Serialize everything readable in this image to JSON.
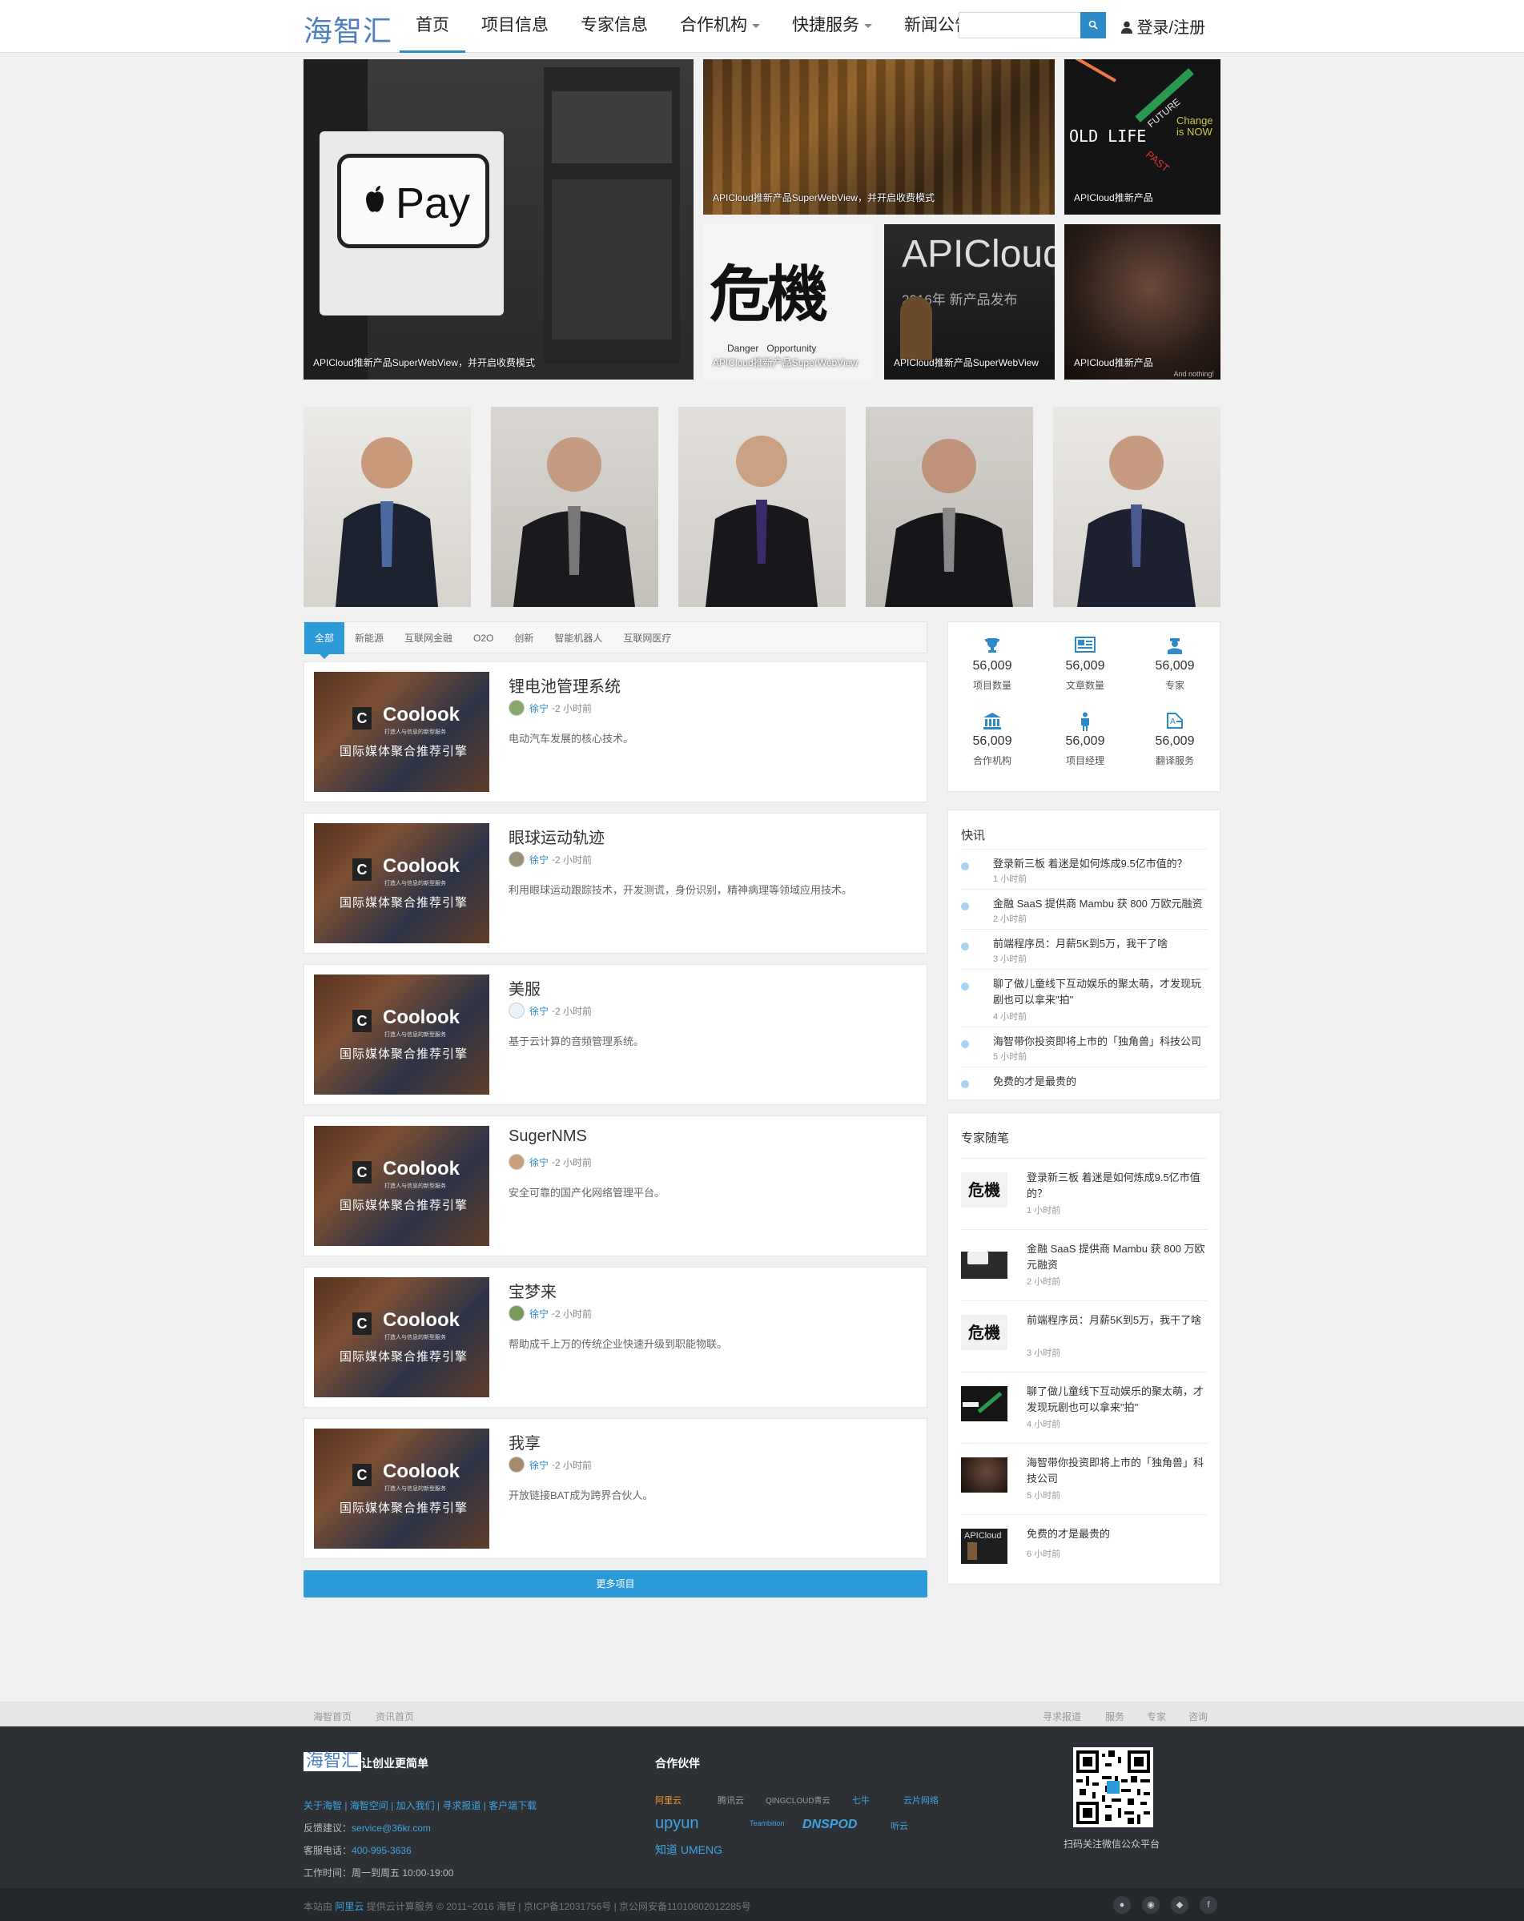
{
  "header": {
    "logo": "海智汇",
    "nav": [
      {
        "label": "首页"
      },
      {
        "label": "项目信息"
      },
      {
        "label": "专家信息"
      },
      {
        "label": "合作机构"
      },
      {
        "label": "快捷服务"
      },
      {
        "label": "新闻公告"
      }
    ],
    "search_placeholder": "",
    "login": "登录/注册"
  },
  "hero": {
    "big": {
      "caption": "APICloud推新产品SuperWebView，并开启收费模式",
      "pay_text": "Pay"
    },
    "tiles": [
      {
        "caption": "APICloud推新产品SuperWebView，并开启收费模式"
      },
      {
        "caption": "APICloud推新产品",
        "overlay_words": [
          "OLD LIFE",
          "FUTURE",
          "PAST",
          "Change is NOW"
        ]
      },
      {
        "caption": "APICloud推新产品SuperWebView",
        "overlay_big": "危機",
        "overlay_small": "Danger   Opportunity"
      },
      {
        "caption": "APICloud推新产品SuperWebView",
        "overlay_big": "APICloud",
        "overlay_small": "2016年 新产品发布"
      },
      {
        "caption": "APICloud推新产品",
        "overlay_small": "And nothing!"
      }
    ]
  },
  "tabs": [
    "全部",
    "新能源",
    "互联网金融",
    "O2O",
    "创新",
    "智能机器人",
    "互联网医疗"
  ],
  "thumb": {
    "brand": "Coolook",
    "sub": "打造人与信息的新型服务",
    "slogan": "国际媒体聚合推荐引擎"
  },
  "projects": [
    {
      "title": "锂电池管理系统",
      "author": "徐宁",
      "time": "2 小时前",
      "desc": "电动汽车发展的核心技术。"
    },
    {
      "title": "眼球运动轨迹",
      "author": "徐宁",
      "time": "2 小时前",
      "desc": "利用眼球运动跟踪技术，开发测谎，身份识别，精神病理等领域应用技术。"
    },
    {
      "title": "美服",
      "author": "徐宁",
      "time": "2 小时前",
      "desc": "基于云计算的音频管理系统。"
    },
    {
      "title": "SugerNMS",
      "author": "徐宁",
      "time": "2 小时前",
      "desc": "安全可靠的国产化网络管理平台。"
    },
    {
      "title": "宝梦来",
      "author": "徐宁",
      "time": "2 小时前",
      "desc": "帮助成千上万的传统企业快速升级到职能物联。"
    },
    {
      "title": "我享",
      "author": "徐宁",
      "time": "2 小时前",
      "desc": "开放链接BAT成为跨界合伙人。"
    }
  ],
  "more_button": "更多项目",
  "stats": [
    {
      "value": "56,009",
      "label": "项目数量",
      "icon": "trophy-icon"
    },
    {
      "value": "56,009",
      "label": "文章数量",
      "icon": "newspaper-icon"
    },
    {
      "value": "56,009",
      "label": "专家",
      "icon": "expert-icon"
    },
    {
      "value": "56,009",
      "label": "合作机构",
      "icon": "bank-icon"
    },
    {
      "value": "56,009",
      "label": "项目经理",
      "icon": "person-icon"
    },
    {
      "value": "56,009",
      "label": "翻译服务",
      "icon": "translate-icon"
    }
  ],
  "flash": {
    "title": "快讯",
    "items": [
      {
        "text": "登录新三板 着迷是如何炼成9.5亿市值的？",
        "time": "1 小时前"
      },
      {
        "text": "金融 SaaS 提供商 Mambu 获 800 万欧元融资",
        "time": "2 小时前"
      },
      {
        "text": "前端程序员：月薪5K到5万，我干了啥",
        "time": "3 小时前"
      },
      {
        "text": "聊了做儿童线下互动娱乐的聚太萌，才发现玩剧也可以拿来\"拍\"",
        "time": "4 小时前"
      },
      {
        "text": "海智带你投资即将上市的「独角兽」科技公司",
        "time": "5 小时前"
      },
      {
        "text": "免费的才是最贵的",
        "time": ""
      }
    ]
  },
  "essays": {
    "title": "专家随笔",
    "items": [
      {
        "text": "登录新三板 着迷是如何炼成9.5亿市值的？",
        "time": "1 小时前"
      },
      {
        "text": "金融 SaaS 提供商 Mambu 获 800 万欧元融资",
        "time": "2 小时前"
      },
      {
        "text": "前端程序员：月薪5K到5万，我干了啥",
        "time": "3 小时前"
      },
      {
        "text": "聊了做儿童线下互动娱乐的聚太萌，才发现玩剧也可以拿来\"拍\"",
        "time": "4 小时前"
      },
      {
        "text": "海智带你投资即将上市的「独角兽」科技公司",
        "time": "5 小时前"
      },
      {
        "text": "免费的才是最贵的",
        "time": "6 小时前"
      }
    ]
  },
  "subfooter": {
    "left": [
      "海智首页",
      "资讯首页"
    ],
    "right": [
      "寻求报道",
      "服务",
      "专家",
      "咨询"
    ]
  },
  "footer": {
    "logo": "海智汇",
    "slogan": "让创业更简单",
    "links": "关于海智 | 海智空间 | 加入我们 | 寻求报道 | 客户端下载",
    "feedback_label": "反馈建议：",
    "feedback": "service@36kr.com",
    "phone_label": "客服电话：",
    "phone": "400-995-3636",
    "hours": "工作时间：周一到周五 10:00-19:00",
    "partners_title": "合作伙伴",
    "partners": [
      "阿里云",
      "腾讯云",
      "QINGCLOUD青云",
      "七牛",
      "云片网络",
      "upyun",
      "Teambition",
      "DNSPOD",
      "听云",
      "知道 UMENG"
    ],
    "qr_caption": "扫码关注微信公众平台",
    "copyright_pre": "本站由",
    "copyright_host": "阿里云",
    "copyright_post": "提供云计算服务 © 2011~2016 海智 | 京ICP备12031756号 | 京公网安备11010802012285号"
  },
  "colors": {
    "accent": "#2d89c7",
    "button": "#2d9ad8",
    "footer": "#2d3035"
  }
}
